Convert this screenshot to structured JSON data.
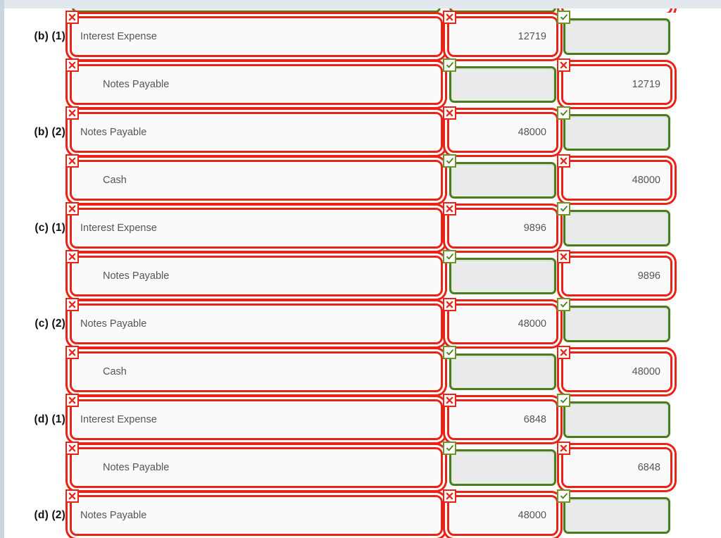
{
  "colors": {
    "wrong_border": "#e82318",
    "right_border": "#4a7d1c",
    "badge_check_border": "#6a9626",
    "field_text": "#555555",
    "disabled_fill": "#e9eaea",
    "page_chrome": "#e3e8ee"
  },
  "icons": {
    "wrong": "x-mark-icon",
    "correct": "check-mark-icon"
  },
  "columns": {
    "account": "account-title-column",
    "debit": "debit-column",
    "credit": "credit-column"
  },
  "clipped_top_row": {
    "account_state": "correct",
    "debit_state": "correct",
    "credit_state": "wrong"
  },
  "rows": [
    {
      "label": "(b) (1)",
      "lines": [
        {
          "indent": false,
          "account": "Interest Expense",
          "account_state": "wrong",
          "debit": "12719",
          "debit_state": "wrong",
          "credit": "",
          "credit_state": "correct"
        },
        {
          "indent": true,
          "account": "Notes Payable",
          "account_state": "wrong",
          "debit": "",
          "debit_state": "correct",
          "credit": "12719",
          "credit_state": "wrong"
        }
      ]
    },
    {
      "label": "(b) (2)",
      "lines": [
        {
          "indent": false,
          "account": "Notes Payable",
          "account_state": "wrong",
          "debit": "48000",
          "debit_state": "wrong",
          "credit": "",
          "credit_state": "correct"
        },
        {
          "indent": true,
          "account": "Cash",
          "account_state": "wrong",
          "debit": "",
          "debit_state": "correct",
          "credit": "48000",
          "credit_state": "wrong"
        }
      ]
    },
    {
      "label": "(c) (1)",
      "lines": [
        {
          "indent": false,
          "account": "Interest Expense",
          "account_state": "wrong",
          "debit": "9896",
          "debit_state": "wrong",
          "credit": "",
          "credit_state": "correct"
        },
        {
          "indent": true,
          "account": "Notes Payable",
          "account_state": "wrong",
          "debit": "",
          "debit_state": "correct",
          "credit": "9896",
          "credit_state": "wrong"
        }
      ]
    },
    {
      "label": "(c) (2)",
      "lines": [
        {
          "indent": false,
          "account": "Notes Payable",
          "account_state": "wrong",
          "debit": "48000",
          "debit_state": "wrong",
          "credit": "",
          "credit_state": "correct"
        },
        {
          "indent": true,
          "account": "Cash",
          "account_state": "wrong",
          "debit": "",
          "debit_state": "correct",
          "credit": "48000",
          "credit_state": "wrong"
        }
      ]
    },
    {
      "label": "(d) (1)",
      "lines": [
        {
          "indent": false,
          "account": "Interest Expense",
          "account_state": "wrong",
          "debit": "6848",
          "debit_state": "wrong",
          "credit": "",
          "credit_state": "correct"
        },
        {
          "indent": true,
          "account": "Notes Payable",
          "account_state": "wrong",
          "debit": "",
          "debit_state": "correct",
          "credit": "6848",
          "credit_state": "wrong"
        }
      ]
    },
    {
      "label": "(d) (2)",
      "lines": [
        {
          "indent": false,
          "account": "Notes Payable",
          "account_state": "wrong",
          "debit": "48000",
          "debit_state": "wrong",
          "credit": "",
          "credit_state": "correct"
        }
      ]
    }
  ]
}
